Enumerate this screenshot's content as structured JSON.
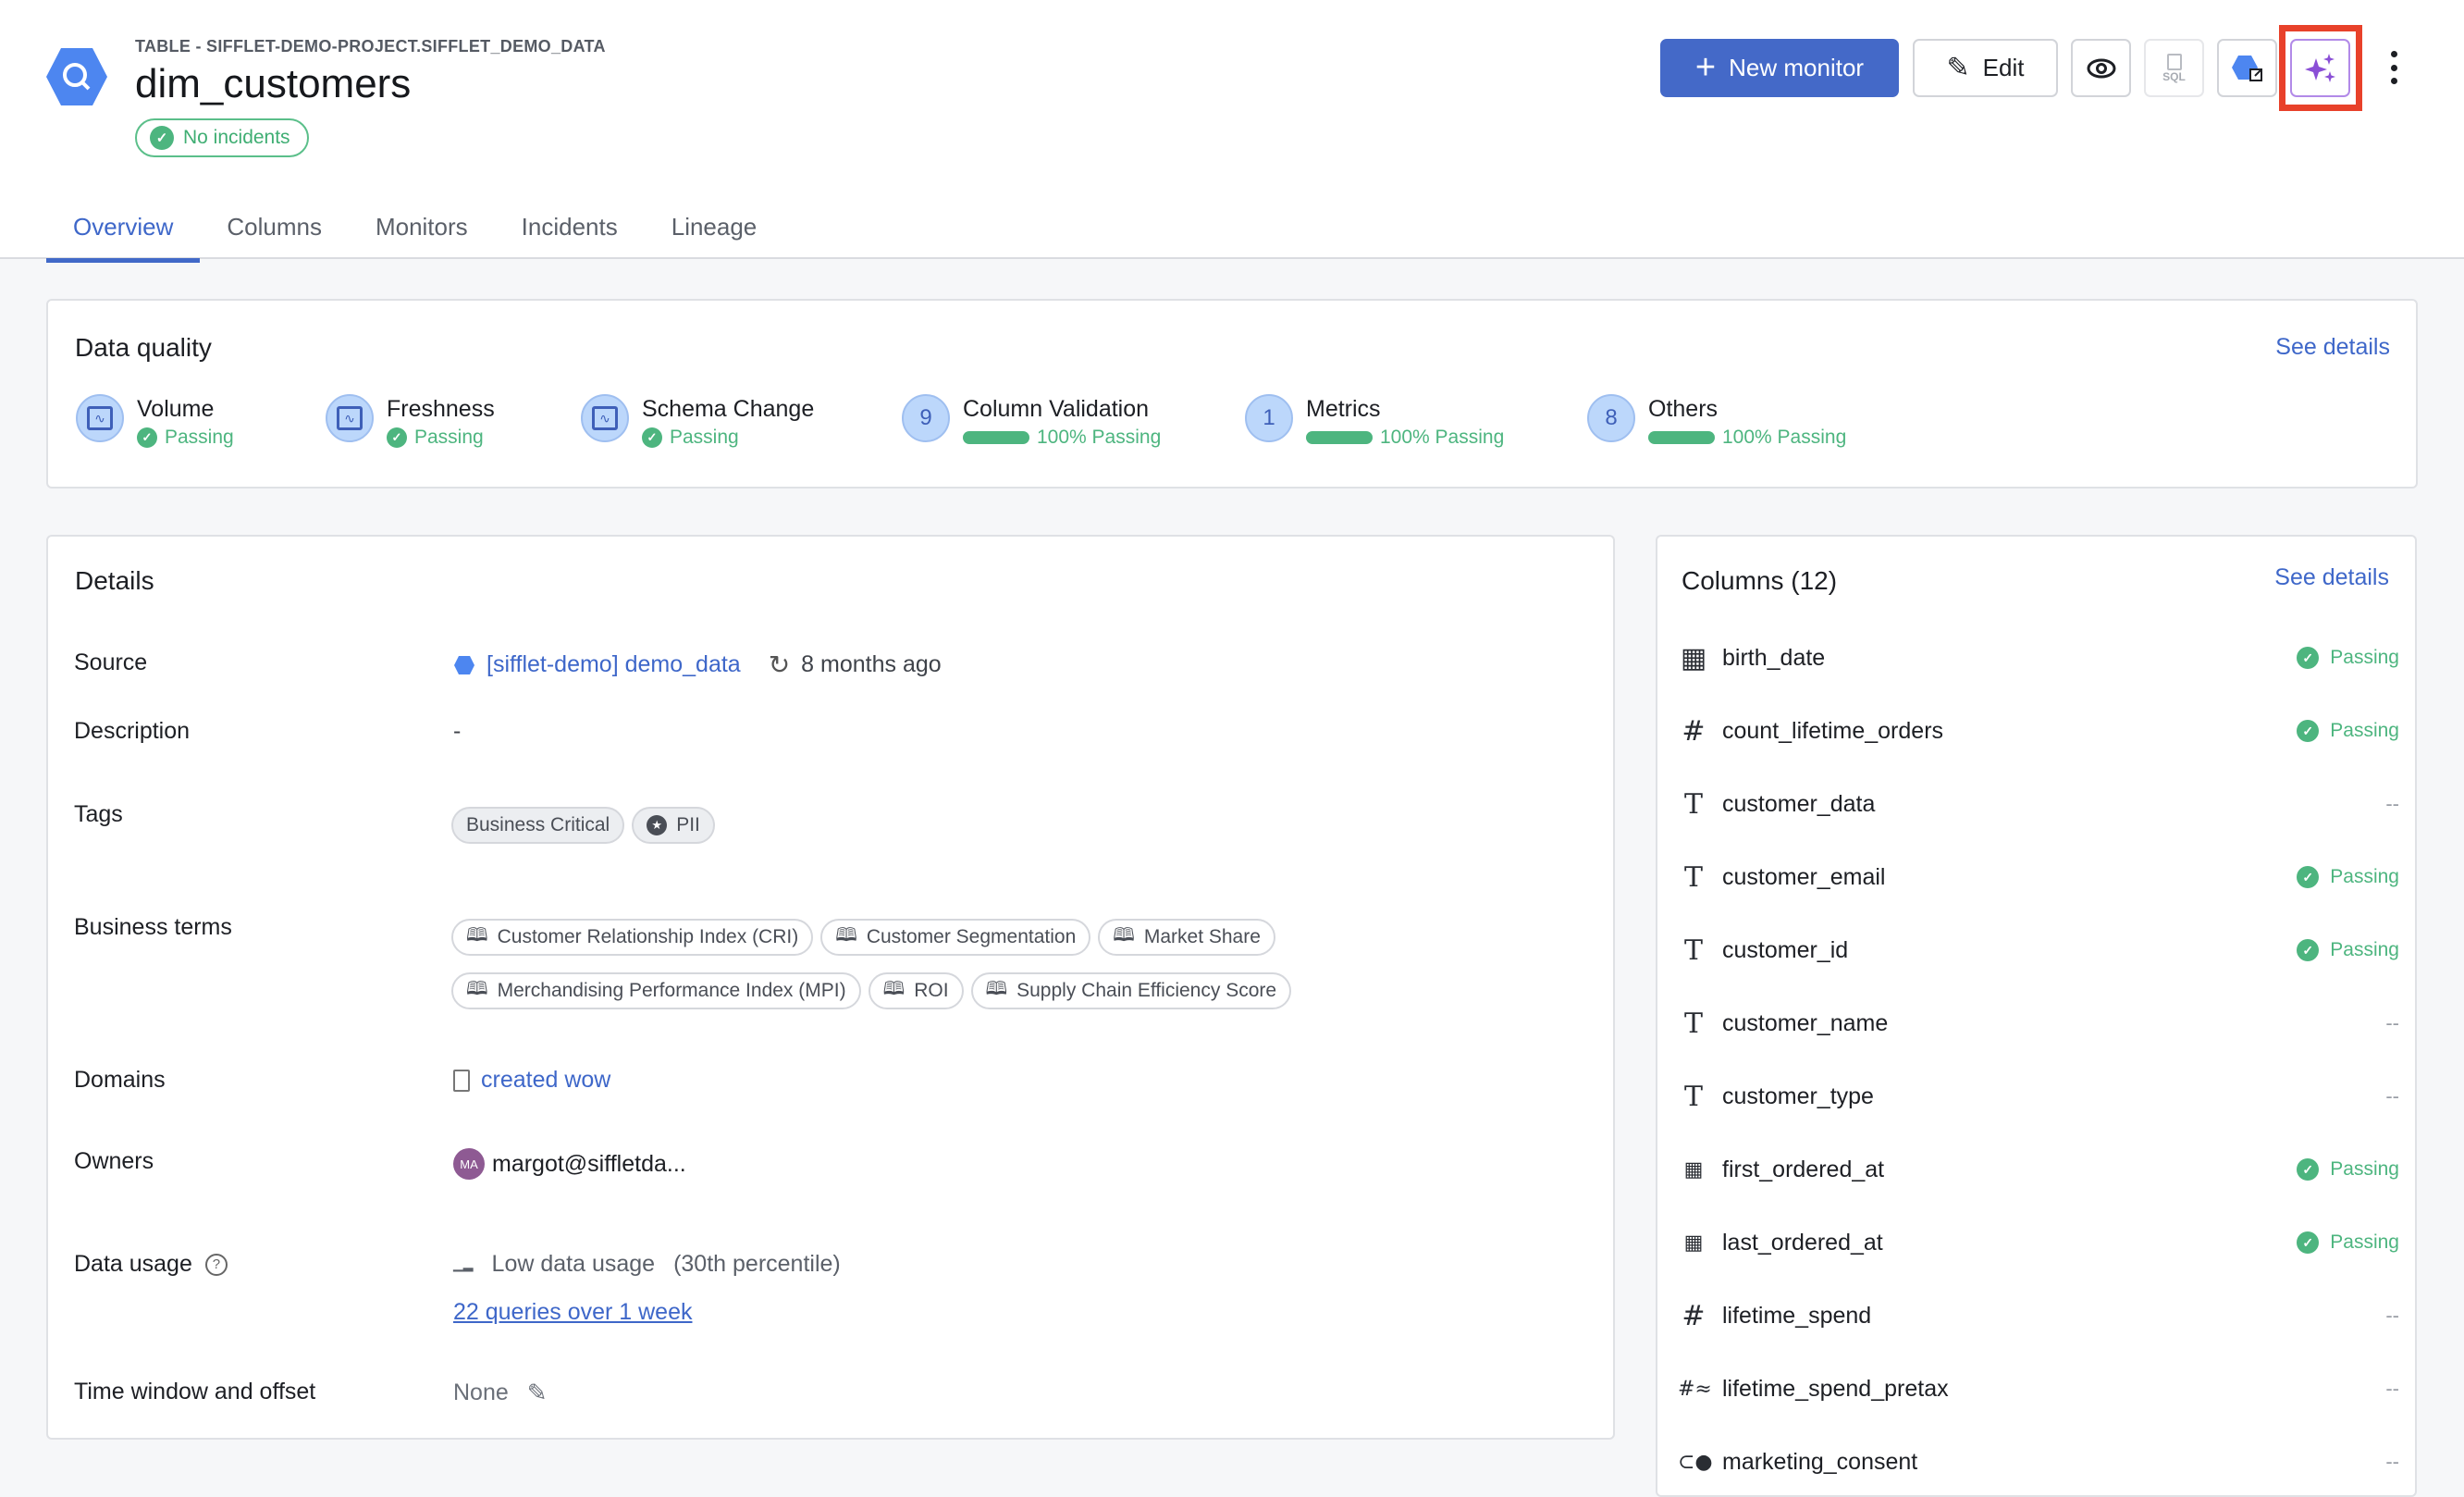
{
  "header": {
    "breadcrumb": "TABLE - SIFFLET-DEMO-PROJECT.SIFFLET_DEMO_DATA",
    "title": "dim_customers",
    "status": "No incidents",
    "actions": {
      "new_monitor": "New monitor",
      "edit": "Edit",
      "sql": "SQL"
    }
  },
  "tabs": [
    {
      "label": "Overview",
      "active": true
    },
    {
      "label": "Columns"
    },
    {
      "label": "Monitors"
    },
    {
      "label": "Incidents"
    },
    {
      "label": "Lineage"
    }
  ],
  "data_quality": {
    "title": "Data quality",
    "see_details": "See details",
    "items": [
      {
        "name": "Volume",
        "badge": "",
        "status": "Passing"
      },
      {
        "name": "Freshness",
        "badge": "",
        "status": "Passing"
      },
      {
        "name": "Schema Change",
        "badge": "",
        "status": "Passing"
      },
      {
        "name": "Column Validation",
        "badge": "9",
        "status": "100% Passing",
        "percent": 100
      },
      {
        "name": "Metrics",
        "badge": "1",
        "status": "100% Passing",
        "percent": 100
      },
      {
        "name": "Others",
        "badge": "8",
        "status": "100% Passing",
        "percent": 100
      }
    ]
  },
  "details": {
    "title": "Details",
    "labels": {
      "source": "Source",
      "description": "Description",
      "tags": "Tags",
      "business_terms": "Business terms",
      "domains": "Domains",
      "owners": "Owners",
      "data_usage": "Data usage",
      "time_window": "Time window and offset"
    },
    "source": "[sifflet-demo] demo_data",
    "refreshed": "8 months ago",
    "description": "-",
    "tags": [
      "Business Critical",
      "PII"
    ],
    "business_terms": [
      "Customer Relationship Index (CRI)",
      "Customer Segmentation",
      "Market Share",
      "Merchandising Performance Index (MPI)",
      "ROI",
      "Supply Chain Efficiency Score"
    ],
    "domain": "created wow",
    "owner_initials": "MA",
    "owner": "margot@siffletda...",
    "usage": "Low data usage",
    "usage_percentile": "(30th percentile)",
    "queries": "22 queries over 1 week",
    "time_window": "None"
  },
  "columns": {
    "title": "Columns (12)",
    "see_details": "See details",
    "items": [
      {
        "name": "birth_date",
        "type": "date",
        "status": "Passing"
      },
      {
        "name": "count_lifetime_orders",
        "type": "number",
        "status": "Passing"
      },
      {
        "name": "customer_data",
        "type": "text",
        "status": "--"
      },
      {
        "name": "customer_email",
        "type": "text",
        "status": "Passing"
      },
      {
        "name": "customer_id",
        "type": "text",
        "status": "Passing"
      },
      {
        "name": "customer_name",
        "type": "text",
        "status": "--"
      },
      {
        "name": "customer_type",
        "type": "text",
        "status": "--"
      },
      {
        "name": "first_ordered_at",
        "type": "datetime",
        "status": "Passing"
      },
      {
        "name": "last_ordered_at",
        "type": "datetime",
        "status": "Passing"
      },
      {
        "name": "lifetime_spend",
        "type": "number",
        "status": "--"
      },
      {
        "name": "lifetime_spend_pretax",
        "type": "approx-number",
        "status": "--"
      },
      {
        "name": "marketing_consent",
        "type": "boolean",
        "status": "--"
      }
    ]
  },
  "colors": {
    "accent": "#4469c8",
    "passing": "#4db57f",
    "ai": "#8a4fd6",
    "highlight": "#e8412a"
  }
}
